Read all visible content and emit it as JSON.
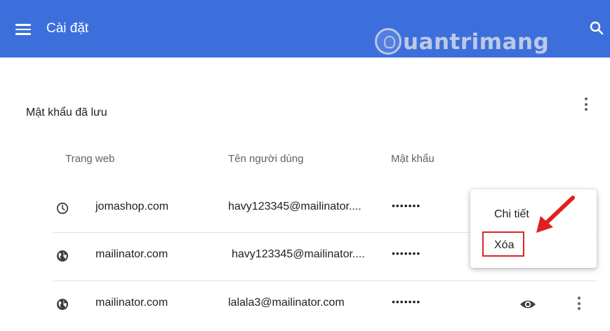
{
  "header": {
    "title": "Cài đặt",
    "menu_icon": "hamburger-menu-icon",
    "search_icon": "search-icon",
    "watermark_text": "uantrimang",
    "bg_color": "#3d6fdc"
  },
  "section": {
    "title": "Mật khẩu đã lưu",
    "more_icon": "more-vert-icon"
  },
  "columns": {
    "site": "Trang web",
    "username": "Tên người dùng",
    "password": "Mật khẩu"
  },
  "rows": [
    {
      "icon": "clock-icon",
      "site": "jomashop.com",
      "username": "havy123345@mailinator....",
      "password": "•••••••"
    },
    {
      "icon": "globe-icon",
      "site": "mailinator.com",
      "username": "havy123345@mailinator....",
      "password": "•••••••"
    },
    {
      "icon": "globe-icon",
      "site": "mailinator.com",
      "username": "lalala3@mailinator.com",
      "password": "•••••••",
      "show_icon": "eye-icon",
      "more_icon": "more-vert-icon"
    }
  ],
  "context_menu": {
    "details_label": "Chi tiết",
    "remove_label": "Xóa"
  },
  "colors": {
    "highlight": "#d9242f",
    "arrow": "#e02020"
  }
}
